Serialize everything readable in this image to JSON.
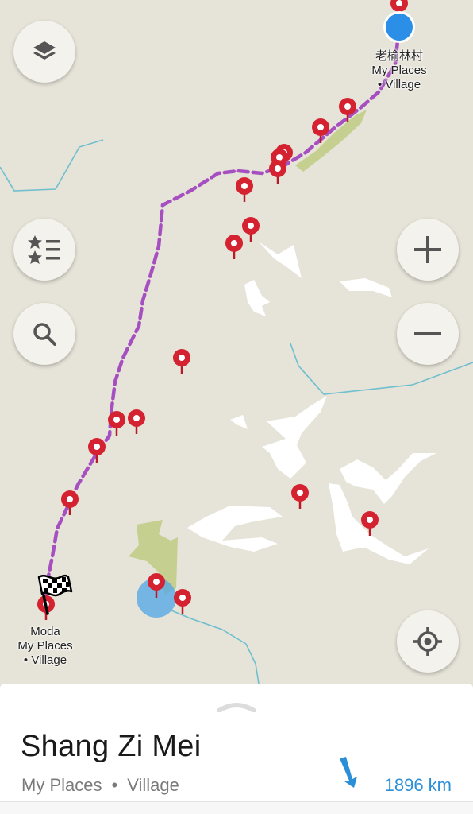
{
  "map": {
    "current_location_label": "老榆林村",
    "start_category": "My Places",
    "start_type": "• Village",
    "destination_name": "Moda",
    "destination_category": "My Places",
    "destination_type": "• Village",
    "colors": {
      "land": "#e6e3d8",
      "route": "#a54fc0",
      "water_line": "#6fbfcf",
      "vegetation": "#c5cf8f",
      "pin": "#d42230",
      "location_dot": "#2b8fe8",
      "accuracy": "#4da6e8"
    }
  },
  "controls": {
    "layers_icon": "layers-icon",
    "bookmarks_icon": "bookmarks-list-icon",
    "search_icon": "search-icon",
    "zoom_in_icon": "plus-icon",
    "zoom_out_icon": "minus-icon",
    "location_icon": "my-location-icon"
  },
  "place_sheet": {
    "title": "Shang Zi Mei",
    "category": "My Places",
    "separator": "•",
    "type": "Village",
    "distance": "1896 km"
  }
}
